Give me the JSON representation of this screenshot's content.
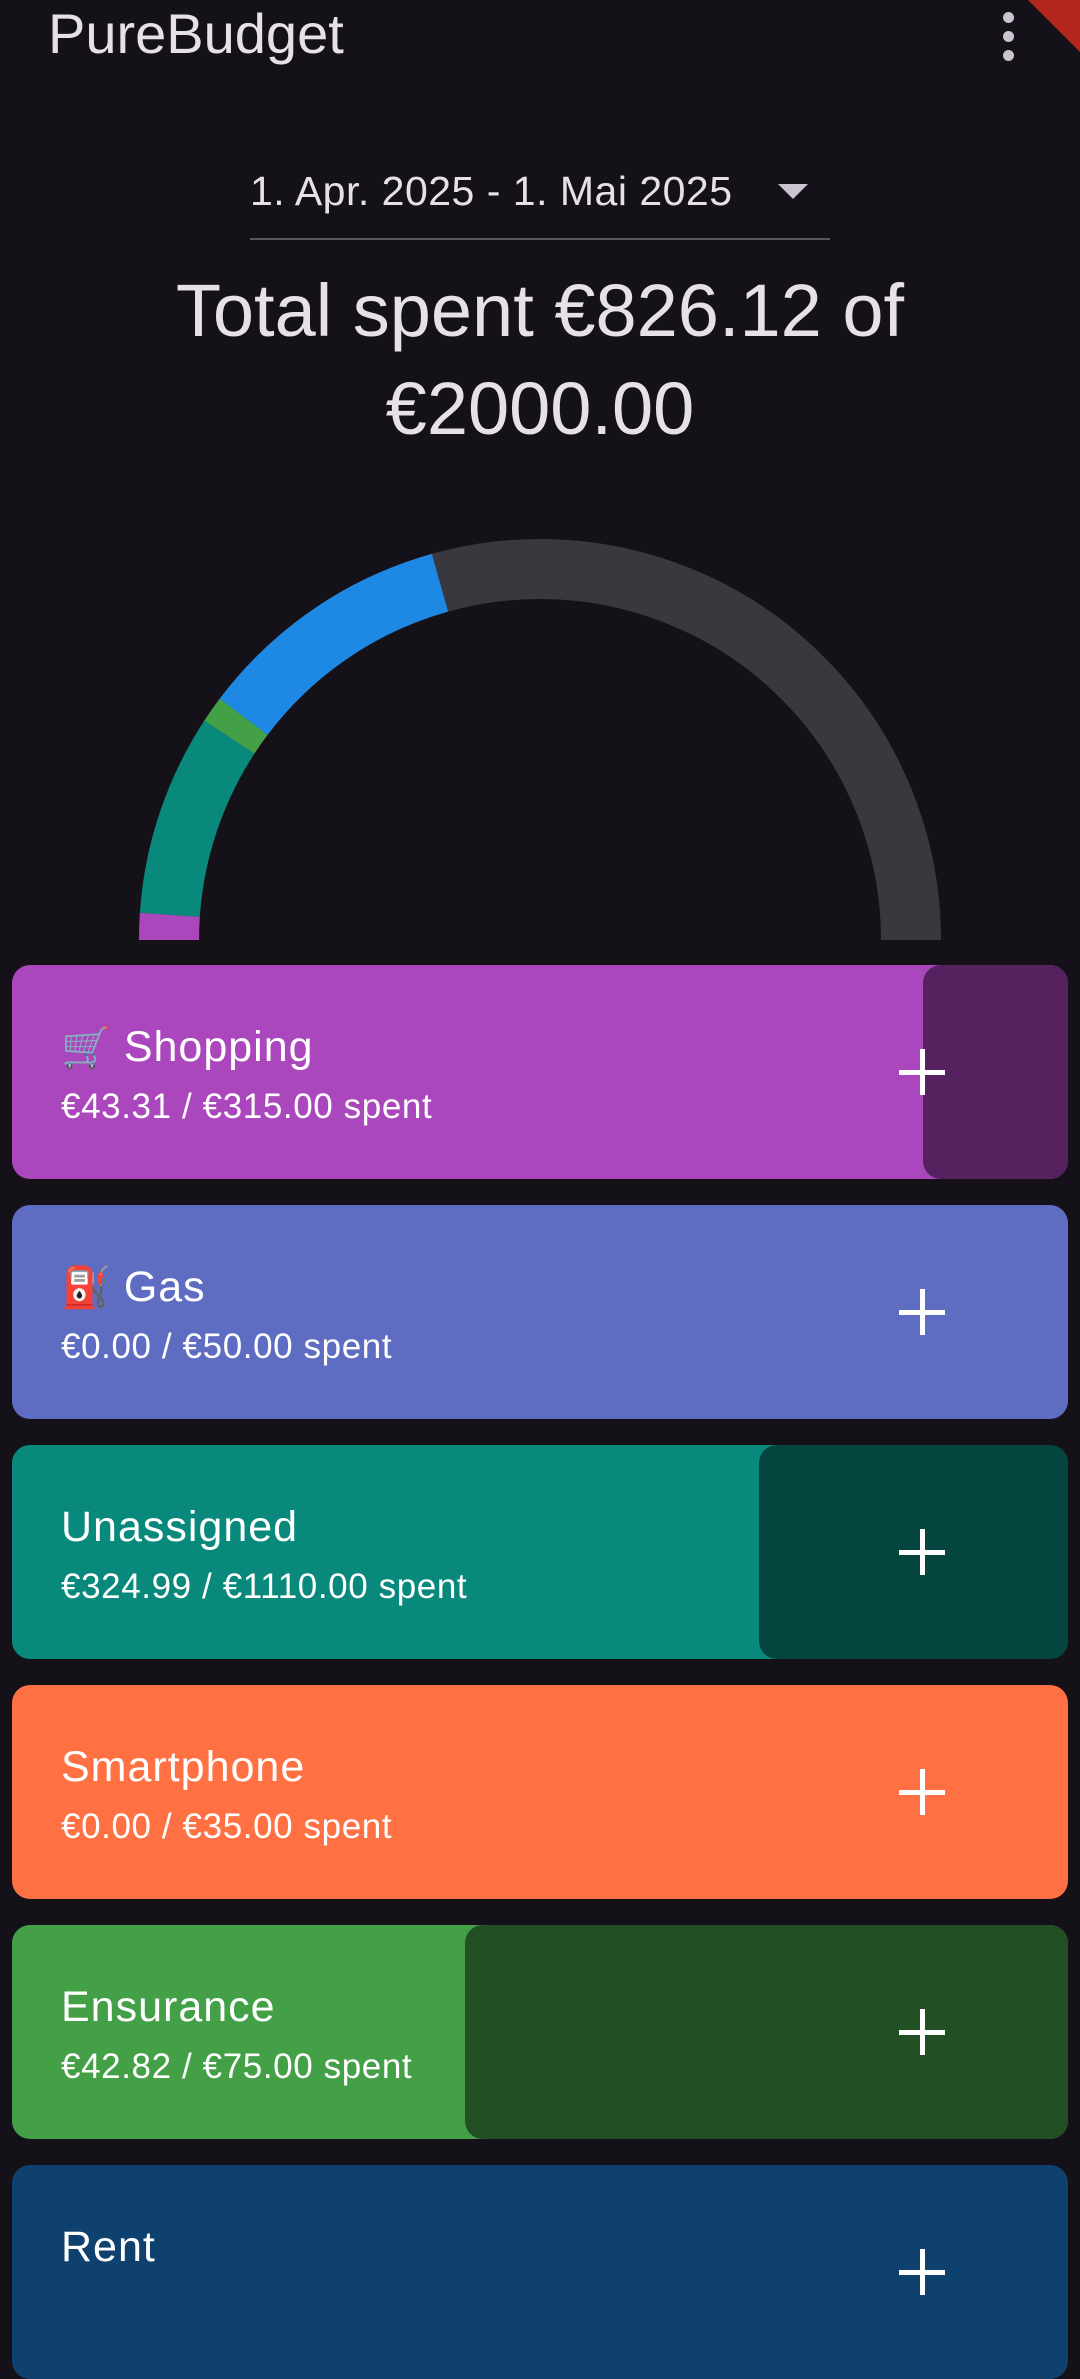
{
  "app": {
    "title": "PureBudget",
    "menu_icon": "more-vert-icon"
  },
  "period": {
    "range": "1. Apr. 2025 - 1. Mai 2025",
    "icon": "arrow-drop-down-icon"
  },
  "summary": {
    "text": "Total spent €826.12 of €2000.00",
    "spent": 826.12,
    "budget": 2000.0
  },
  "gauge": {
    "total_budget": 2000.0,
    "track_color": "#3A383F",
    "segments": [
      {
        "category": "Shopping",
        "value": 43.31,
        "color": "#AB47BC"
      },
      {
        "category": "Unassigned",
        "value": 324.99,
        "color": "#08897B"
      },
      {
        "category": "Ensurance",
        "value": 42.82,
        "color": "#43A047"
      },
      {
        "category": "Rent",
        "value": 415.0,
        "color": "#1E88E5"
      }
    ]
  },
  "categories": [
    {
      "emoji": "🛒",
      "name": "Shopping",
      "amount_text": "€43.31 / €315.00 spent",
      "spent": 43.31,
      "budget": 315.0,
      "color": "#AB47BC",
      "progress_color": "#55215F",
      "add_icon": "add-icon"
    },
    {
      "emoji": "⛽",
      "name": "Gas",
      "amount_text": "€0.00 / €50.00 spent",
      "spent": 0.0,
      "budget": 50.0,
      "color": "#5E6CC1",
      "progress_color": "#2F3660",
      "add_icon": "add-icon"
    },
    {
      "emoji": "",
      "name": "Unassigned",
      "amount_text": "€324.99 / €1110.00 spent",
      "spent": 324.99,
      "budget": 1110.0,
      "color": "#08897B",
      "progress_color": "#04453F",
      "add_icon": "add-icon"
    },
    {
      "emoji": "",
      "name": "Smartphone",
      "amount_text": "€0.00 / €35.00 spent",
      "spent": 0.0,
      "budget": 35.0,
      "color": "#FF7043",
      "progress_color": "#803822",
      "add_icon": "add-icon"
    },
    {
      "emoji": "",
      "name": "Ensurance",
      "amount_text": "€42.82 / €75.00 spent",
      "spent": 42.82,
      "budget": 75.0,
      "color": "#43A047",
      "progress_color": "#224F23",
      "add_icon": "add-icon"
    },
    {
      "emoji": "",
      "name": "Rent",
      "amount_text": "",
      "spent": null,
      "budget": null,
      "color": "#0F416F",
      "progress_color": "#0F416F",
      "add_icon": "add-icon"
    }
  ]
}
